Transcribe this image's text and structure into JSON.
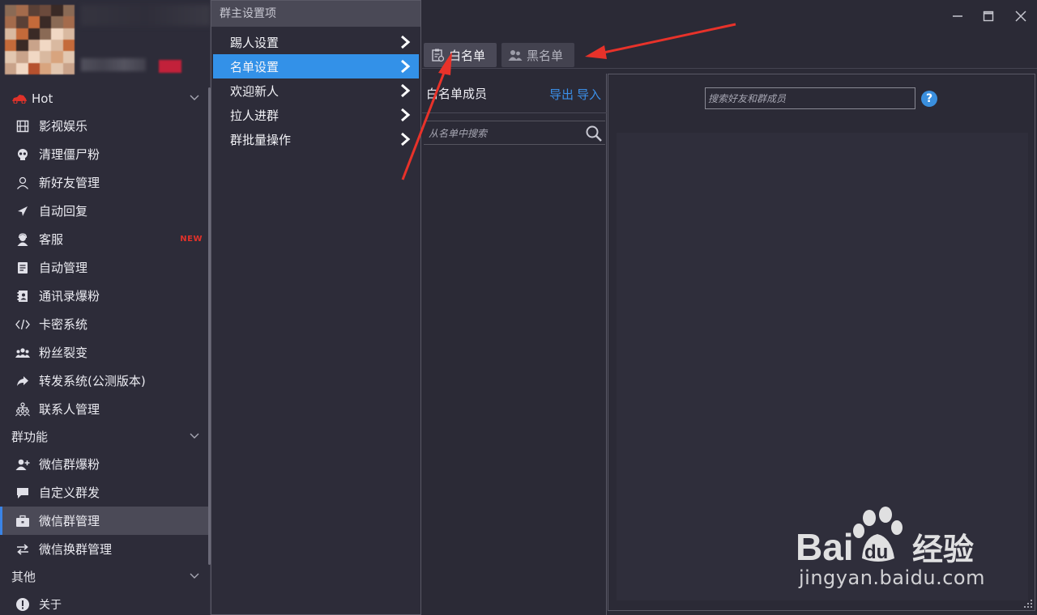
{
  "sidebar": {
    "sections": [
      {
        "label": "Hot"
      },
      {
        "label": "群功能"
      },
      {
        "label": "其他"
      }
    ],
    "hot_items": [
      {
        "label": "影视娱乐",
        "icon": "film-icon"
      },
      {
        "label": "清理僵尸粉",
        "icon": "skull-icon"
      },
      {
        "label": "新好友管理",
        "icon": "user-outline-icon"
      },
      {
        "label": "自动回复",
        "icon": "send-icon"
      },
      {
        "label": "客服",
        "icon": "agent-icon",
        "badge": "NEW"
      },
      {
        "label": "自动管理",
        "icon": "doc-icon"
      },
      {
        "label": "通讯录爆粉",
        "icon": "contacts-book-icon"
      },
      {
        "label": "卡密系统",
        "icon": "code-icon"
      },
      {
        "label": "粉丝裂变",
        "icon": "group-icon"
      },
      {
        "label": "转发系统(公测版本)",
        "icon": "share-arrow-icon"
      },
      {
        "label": "联系人管理",
        "icon": "org-chart-icon"
      }
    ],
    "group_items": [
      {
        "label": "微信群爆粉",
        "icon": "user-plus-icon"
      },
      {
        "label": "自定义群发",
        "icon": "chat-bubble-icon"
      },
      {
        "label": "微信群管理",
        "icon": "briefcase-icon",
        "active": true
      },
      {
        "label": "微信换群管理",
        "icon": "swap-icon"
      }
    ],
    "other_items": [
      {
        "label": "关于",
        "icon": "info-icon"
      }
    ]
  },
  "popup": {
    "title": "群主设置项",
    "items": [
      {
        "label": "踢人设置"
      },
      {
        "label": "名单设置",
        "selected": true
      },
      {
        "label": "欢迎新人"
      },
      {
        "label": "拉人进群"
      },
      {
        "label": "群批量操作"
      }
    ]
  },
  "tabs": {
    "whitelist": "白名单",
    "blacklist": "黑名单"
  },
  "list_panel": {
    "header": "白名单成员",
    "export": "导出",
    "import": "导入",
    "search_placeholder": "从名单中搜索"
  },
  "right_panel": {
    "search_placeholder": "搜索好友和群成员",
    "help": "?"
  },
  "watermark": {
    "url": "jingyan.baidu.com",
    "brand": "Bai",
    "brand2": "du",
    "brand3": "经验"
  },
  "colors": {
    "accent": "#3391e8",
    "link": "#3b8fe8",
    "new_badge": "#e0322a",
    "annotation_arrow": "#e8322a"
  }
}
